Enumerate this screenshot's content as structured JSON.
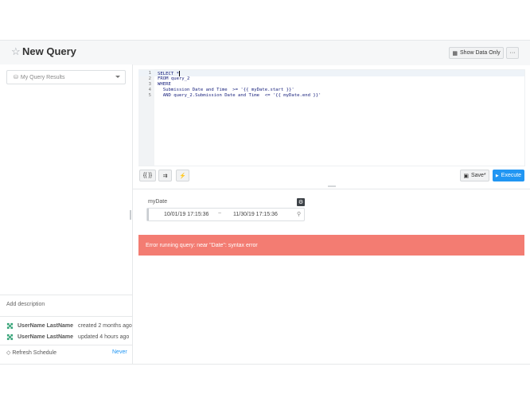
{
  "header": {
    "title": "New Query",
    "show_data_only_label": "Show Data Only",
    "more_label": "···"
  },
  "sidebar": {
    "results_placeholder": "My Query Results",
    "add_description": "Add description",
    "users": [
      {
        "name": "UserName LastName",
        "action": "created 2 months ago"
      },
      {
        "name": "UserName LastName",
        "action": "updated 4 hours ago"
      }
    ],
    "refresh_label": "Refresh Schedule",
    "refresh_value": "Never"
  },
  "editor": {
    "lines": [
      {
        "num": "1",
        "text": "SELECT *"
      },
      {
        "num": "2",
        "text": "FROM query_2"
      },
      {
        "num": "3",
        "text": "WHERE"
      },
      {
        "num": "4",
        "text": "  Submission Date and Time  >= '{{ myDate.start }}'"
      },
      {
        "num": "5",
        "text": "  AND query_2.Submission Date and Time  <= '{{ myDate.end }}'"
      }
    ]
  },
  "toolbar": {
    "params_label": "{{ }}",
    "format_label": "⇉",
    "autocomplete_label": "⚡",
    "save_label": "Save*",
    "execute_label": "Execute"
  },
  "parameter": {
    "name": "myDate",
    "start": "10/01/19 17:15:36",
    "separator": "~",
    "end": "11/30/19 17:15:36"
  },
  "error": {
    "message": "Error running query: near \"Date\": syntax error"
  },
  "colors": {
    "accent": "#2196f3",
    "error_bg": "#f37c72"
  }
}
